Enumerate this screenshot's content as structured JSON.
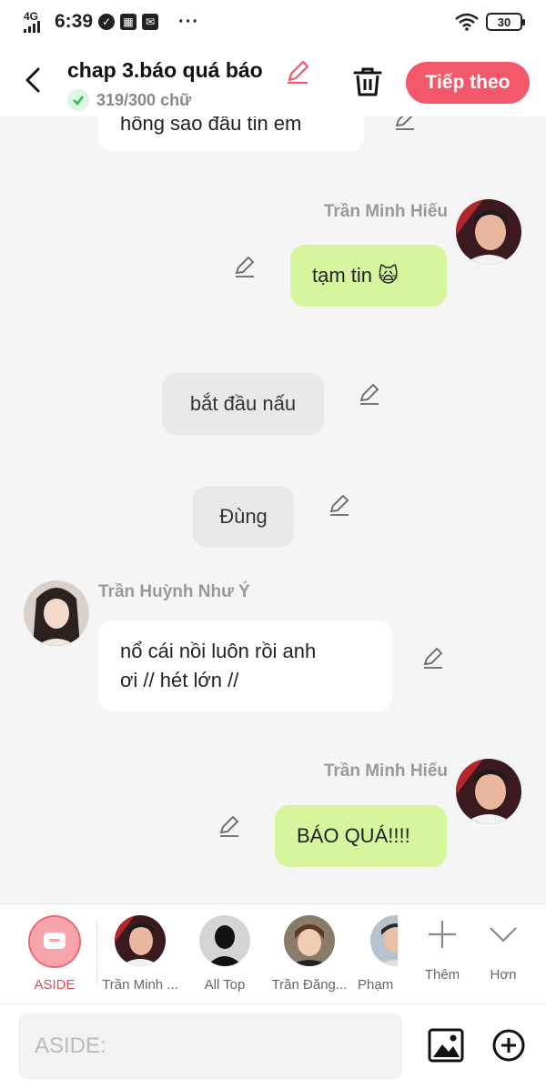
{
  "status_bar": {
    "network": "4G",
    "time": "6:39",
    "battery": "30",
    "more": "···"
  },
  "header": {
    "title": "chap 3.báo quá báo",
    "word_count": "319/300 chữ",
    "next_label": "Tiếp theo",
    "accent_color": "#f3576a"
  },
  "messages": {
    "m0": {
      "text": "hông sao đâu tin em"
    },
    "m1": {
      "speaker": "Trần Minh Hiếu",
      "text": "tạm tin 🙀"
    },
    "m2": {
      "text": "bắt đầu nấu"
    },
    "m3": {
      "text": "Đùng"
    },
    "m4": {
      "speaker": "Trần Huỳnh Như Ý",
      "line1": "nổ cái nồi luôn rồi anh",
      "line2": "ơi // hét lớn //"
    },
    "m5": {
      "speaker": "Trần Minh Hiếu",
      "text": "BÁO QUÁ!!!!"
    }
  },
  "characters": {
    "aside": "ASIDE",
    "c1": "Trần Minh ...",
    "c2": "All Top",
    "c3": "Trần Đăng...",
    "c4": "Phạm",
    "more": "Thêm",
    "collapse": "Hơn"
  },
  "input": {
    "placeholder": "ASIDE:"
  },
  "icons": [
    "signal-icon",
    "shield-icon",
    "calendar-icon",
    "mail-icon",
    "wifi-icon",
    "battery-icon",
    "back-icon",
    "edit-icon",
    "check-icon",
    "trash-icon",
    "pencil-icon",
    "aside-icon",
    "plus-icon",
    "chevron-down-icon",
    "image-icon",
    "plus-circle-icon"
  ]
}
